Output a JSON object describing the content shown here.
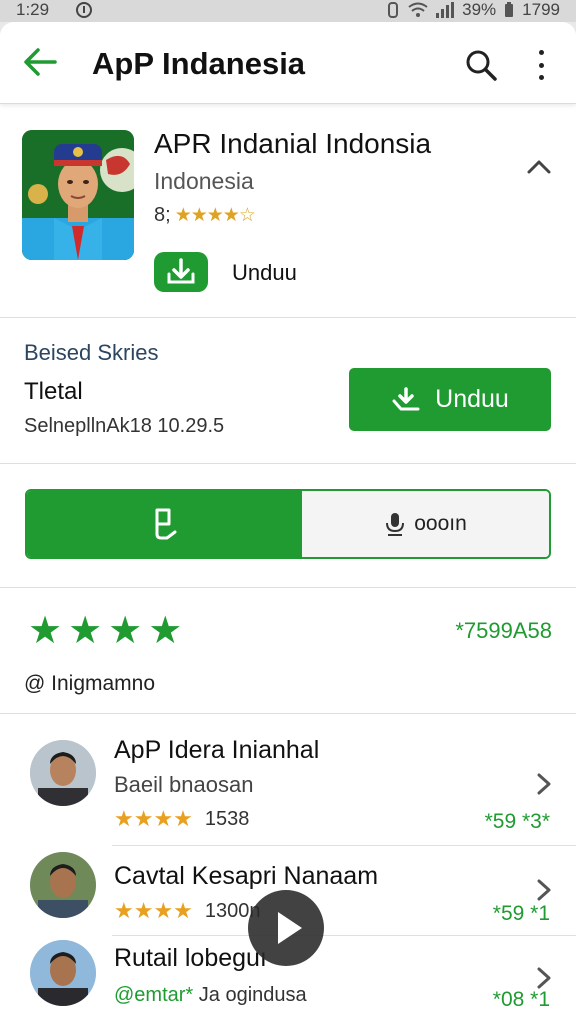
{
  "status_bar": {
    "time": "1:29",
    "battery": "39%",
    "right_time": "1799"
  },
  "app_bar": {
    "title": "ApP Indanesia"
  },
  "app": {
    "name": "APR Indanial Indonsia",
    "subtitle": "Indonesia",
    "rating_prefix": "8;",
    "rating_stars": "★★★★☆",
    "install_label": "Unduu"
  },
  "details": {
    "heading": "Beised Skries",
    "label": "Tletal",
    "meta": "SelnepllnAk18 10.29.5",
    "download_label": "Unduu"
  },
  "toggle": {
    "right_label": "oooın"
  },
  "rating": {
    "stars": "★★★★",
    "count": "*7599A58",
    "user": "@ Inigmamno"
  },
  "list": [
    {
      "title": "ApP Idera Inianhal",
      "subtitle": "Baeil bnaosan",
      "stars": "★★★★",
      "count": "1538",
      "score": "*59 *3*"
    },
    {
      "title": "Cavtal Kesapri Nanaam",
      "stars": "★★★★",
      "count": "1300n",
      "score": "*59 *1"
    },
    {
      "title": "Rutail lobeguı",
      "extra_green": "@emtar*",
      "extra": "Ja ogindusa",
      "score": "*08 *1"
    }
  ]
}
